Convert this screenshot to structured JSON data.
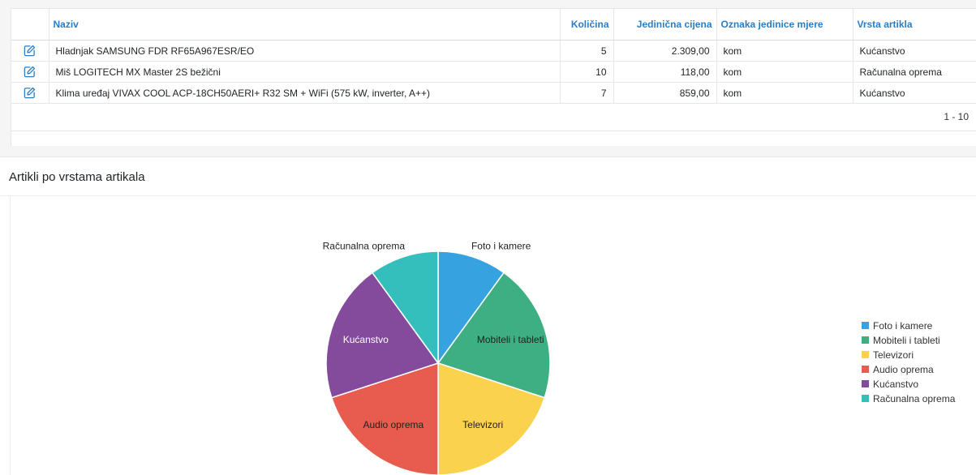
{
  "grid": {
    "columns": {
      "name": "Naziv",
      "qty": "Količina",
      "price": "Jedinična cijena",
      "unit": "Oznaka jedinice mjere",
      "type": "Vrsta artikla"
    },
    "rows": [
      {
        "name": "Hladnjak SAMSUNG FDR RF65A967ESR/EO",
        "qty": "5",
        "price": "2.309,00",
        "unit": "kom",
        "type": "Kućanstvo"
      },
      {
        "name": "Miš LOGITECH MX Master 2S bežični",
        "qty": "10",
        "price": "118,00",
        "unit": "kom",
        "type": "Računalna oprema"
      },
      {
        "name": "Klima uređaj VIVAX COOL ACP-18CH50AERI+ R32 SM + WiFi (575 kW, inverter, A++)",
        "qty": "7",
        "price": "859,00",
        "unit": "kom",
        "type": "Kućanstvo"
      }
    ],
    "pager": "1 - 10",
    "edit_icon": "edit-icon"
  },
  "chart": {
    "title": "Artikli po vrstama artikala"
  },
  "chart_data": {
    "type": "pie",
    "title": "Artikli po vrstama artikala",
    "slices": [
      {
        "label": "Foto i kamere",
        "value": 1,
        "color": "#36a2e0"
      },
      {
        "label": "Mobiteli i tableti",
        "value": 2,
        "color": "#3daf82"
      },
      {
        "label": "Televizori",
        "value": 2,
        "color": "#fad24d"
      },
      {
        "label": "Audio oprema",
        "value": 2,
        "color": "#e85c50"
      },
      {
        "label": "Kućanstvo",
        "value": 2,
        "color": "#844b9c"
      },
      {
        "label": "Računalna oprema",
        "value": 1,
        "color": "#34bfbd"
      }
    ],
    "legend": "right",
    "labels_outside": [
      "Foto i kamere",
      "Računalna oprema"
    ]
  }
}
